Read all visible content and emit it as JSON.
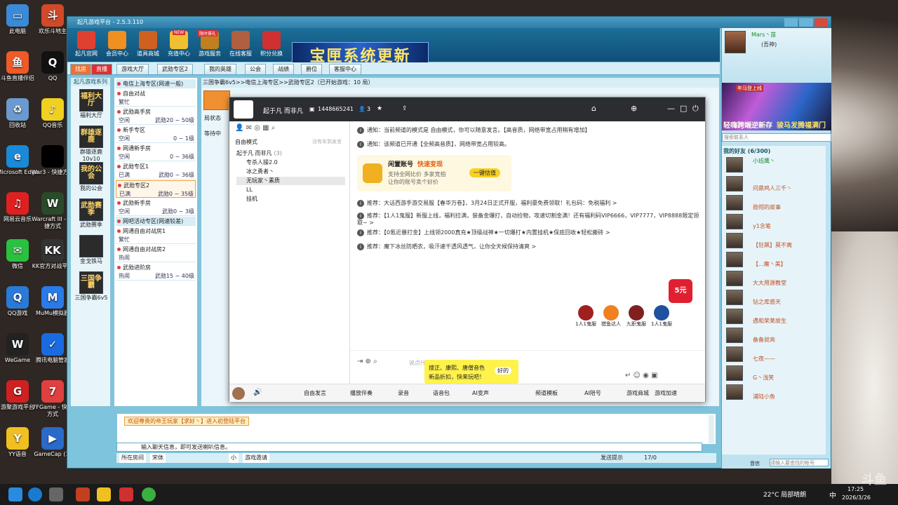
{
  "desktop": {
    "icons": [
      {
        "label": "此电脑",
        "color": "#3a8ad8",
        "glyph": "▭"
      },
      {
        "label": "斗鱼直播伴侣",
        "color": "#f05a28",
        "glyph": "鱼"
      },
      {
        "label": "回收站",
        "color": "#6a9ad0",
        "glyph": "♻"
      },
      {
        "label": "Microsoft Edge",
        "color": "#1a8ad8",
        "glyph": "e"
      },
      {
        "label": "网易云音乐",
        "color": "#e02020",
        "glyph": "♫"
      },
      {
        "label": "微信",
        "color": "#2ac040",
        "glyph": "✉"
      },
      {
        "label": "QQ游戏",
        "color": "#2a7ad8",
        "glyph": "Q"
      },
      {
        "label": "WeGame",
        "color": "#222",
        "glyph": "W"
      },
      {
        "label": "游聚游戏平台",
        "color": "#d02020",
        "glyph": "G"
      },
      {
        "label": "YY语音",
        "color": "#f0c020",
        "glyph": "Y"
      }
    ],
    "icons2": [
      {
        "label": "欢乐斗地主",
        "color": "#d04a2a",
        "glyph": "斗"
      },
      {
        "label": "QQ",
        "color": "#111",
        "glyph": "Q"
      },
      {
        "label": "QQ音乐",
        "color": "#f0d020",
        "glyph": "♪"
      },
      {
        "label": "War3 - 快捷方式",
        "color": "#000",
        "glyph": ""
      },
      {
        "label": "Warcraft III - 快捷方式",
        "color": "#2a4a2a",
        "glyph": "W"
      },
      {
        "label": "KK官方对战平台",
        "color": "#333",
        "glyph": "KK"
      },
      {
        "label": "MuMu模拟器",
        "color": "#2a7ae8",
        "glyph": "M"
      },
      {
        "label": "腾讯电脑管家",
        "color": "#1a6ae0",
        "glyph": "✓"
      },
      {
        "label": "7FGame - 快捷方式",
        "color": "#e04040",
        "glyph": "7"
      },
      {
        "label": "GameCap (1)",
        "color": "#2a6ac8",
        "glyph": "▶"
      }
    ]
  },
  "app": {
    "title": "起凡游戏平台 - 2.5.3.110",
    "top_buttons": [
      "起凡官网",
      "会员中心",
      "道具商城",
      "充值中心",
      "游戏服务",
      "在线客服",
      "积分兑换"
    ],
    "badges": {
      "new": "NEW",
      "recharge": "限时豪礼"
    },
    "banner": "宝匣系统更新",
    "tabs": [
      "游戏大厅",
      "武勋专区2",
      "我的英雄",
      "公会",
      "战绩",
      "爵位",
      "客服中心"
    ],
    "tab_left": [
      "找房",
      "直播"
    ],
    "left_nav": [
      {
        "label": "福利大厅",
        "glyph": "福利大厅"
      },
      {
        "label": "群雄逐鹿10v10",
        "glyph": "群雄逐鹿"
      },
      {
        "label": "我的公会",
        "glyph": "我的公会"
      },
      {
        "label": "武勋赛季",
        "glyph": "武勋赛季"
      },
      {
        "label": "金戈铁马",
        "glyph": ""
      },
      {
        "label": "三国争霸6v5",
        "glyph": "三国争霸"
      }
    ],
    "left_nav_header": "起凡游戏系列",
    "rooms": [
      {
        "hdr": true,
        "name": "电信上海专区(网速一般)"
      },
      {
        "name": "自由对战",
        "status": "繁忙",
        "rank": ""
      },
      {
        "name": "武勋高手房",
        "status": "空闲",
        "rank": "武勋20 ~ 50级"
      },
      {
        "name": "新手专区",
        "status": "空闲",
        "rank": "0 ~ 1级"
      },
      {
        "name": "网通新手房",
        "status": "空闲",
        "rank": "0 ~ 36级"
      },
      {
        "name": "武勋专区1",
        "status": "已满",
        "rank": "武勋0 ~ 36级"
      },
      {
        "name": "武勋专区2",
        "status": "已满",
        "rank": "武勋0 ~ 35级",
        "sel": true
      },
      {
        "name": "武勋新手房",
        "status": "空闲",
        "rank": "武勋0 ~ 3级"
      },
      {
        "hdr": true,
        "name": "网吧活动专区(网速较差)"
      },
      {
        "name": "网通自由对战房1",
        "status": "繁忙",
        "rank": ""
      },
      {
        "name": "网通自由对战房2",
        "status": "热闹",
        "rank": ""
      },
      {
        "name": "武勋进阶房",
        "status": "热闹",
        "rank": "武勋15 ~ 40级"
      }
    ],
    "breadcrumb": "三国争霸6v5>>电信上海专区>>武勋专区2（已开始游戏：10 局）",
    "main_cols": [
      "局状态",
      "房"
    ],
    "main_row": "等待中",
    "lowchat_text": "欢迎尊贵的帝王玩家【求好丶】进入初登陆平台",
    "chat_input_placeholder": "输入聊天信息，即可发送喇叭信息。",
    "bottom_bar": {
      "scope": "所在房间",
      "font": "宋体",
      "size": "小",
      "invite": "游戏邀请",
      "send_hint": "发送提示",
      "count": "17/0"
    }
  },
  "right_panel": {
    "username": "Mars丶苗",
    "status": "(吾神)",
    "banner_title": "轻嗨跨端逆新存",
    "banner_sub": "骏马发腾福满门",
    "banner_tag": "年马登上线",
    "search_placeholder": "搜索联系人",
    "group": "我的好友 (6/300)",
    "friends": [
      {
        "name": "小班鹰丶",
        "status": ""
      },
      {
        "name": "",
        "status": "问鼎鸡人三千丶"
      },
      {
        "name": "",
        "status": "勋彻的故事"
      },
      {
        "name": "",
        "status": "y1念笔"
      },
      {
        "name": "",
        "status": "【狂飙】莫不离"
      },
      {
        "name": "",
        "status": "【...魔丶美】"
      },
      {
        "name": "",
        "status": "大大用源教堂"
      },
      {
        "name": "",
        "status": "钻之库惑天"
      },
      {
        "name": "",
        "status": "遇和荣莱故生"
      },
      {
        "name": "",
        "status": "备备就亮"
      },
      {
        "name": "",
        "status": "七夜——"
      },
      {
        "name": "",
        "status": "G丶浅笑"
      },
      {
        "name": "",
        "status": "浦陆小鱼"
      }
    ],
    "bottom_links": [
      "音信",
      "请输入要查找的帐号"
    ]
  },
  "dialog": {
    "channel": "起于凡 而非凡",
    "id": "1448665241",
    "online": "3",
    "side_tabs_mode": "自由模式",
    "side_tabs_hint": "没有车到发言",
    "members": [
      {
        "name": "起于凡 而非凡",
        "tag": "(3)"
      },
      {
        "name": "专杀人操2.0",
        "tag": ""
      },
      {
        "name": "冰之勇者丶",
        "tag": ""
      },
      {
        "name": "无玩家丶素质",
        "tag": ""
      },
      {
        "name": "LL",
        "tag": ""
      },
      {
        "name": "挂机",
        "tag": ""
      }
    ],
    "messages": [
      {
        "icon": "i",
        "text": "通知：当前频道的模式是 自由模式，你可以随意发言。【高音质，网络带宽占用稍有增加】"
      },
      {
        "icon": "i",
        "text": "通知：该频道已开通【全频高音质】，网络带宽占用较高。"
      },
      {
        "icon": "i",
        "text": "推荐：大话西游手游交易服【春华万卷】，3月24日正式开服，福利豪免费领取！礼包码：免税福利 >"
      },
      {
        "icon": "i",
        "text": "推荐：【1人1鬼服】新服上线，福利拉满，装备金爆打，自动捡物，攻速切割金满！还有福利码VIP6666，VIP7777，VIP8888限定领取~ >"
      },
      {
        "icon": "i",
        "text": "推荐：【0氪近暴打金】上线领2000真充★顶级战神★一切爆打★内置挂机★保底回收★轻松搬砖 >"
      },
      {
        "icon": "i",
        "text": "推荐：魔下冰丝防晒衣，吸汗速干透风透气，让你全天候保持清爽 >"
      }
    ],
    "promo": {
      "title": "闲置账号",
      "title2": "快速变现",
      "sub1": "支持全网比价 多家竞拍",
      "sub2": "让你的账号卖个好价",
      "button": "一键估值"
    },
    "promo_badge": "5元",
    "games": [
      "1人1鬼服",
      "猎鱼达人",
      "九职鬼服",
      "1人1鬼服"
    ],
    "tooltip": {
      "line1": "搜正、康熙、唐僧音色",
      "line2": "新品折扣，快来玩吧！",
      "button": "好的"
    },
    "input_placeholder": "说点什么",
    "footer": [
      "自由发言",
      "播放伴奏",
      "录音",
      "语音包",
      "AI变声",
      "频道模板",
      "AI陪号",
      "游戏商城",
      "游戏加速"
    ]
  },
  "taskbar": {
    "weather": "22°C 局部晴朗",
    "ime": "中",
    "time": "17:25",
    "date": "2026/3/26"
  },
  "watermark": "斗鱼"
}
